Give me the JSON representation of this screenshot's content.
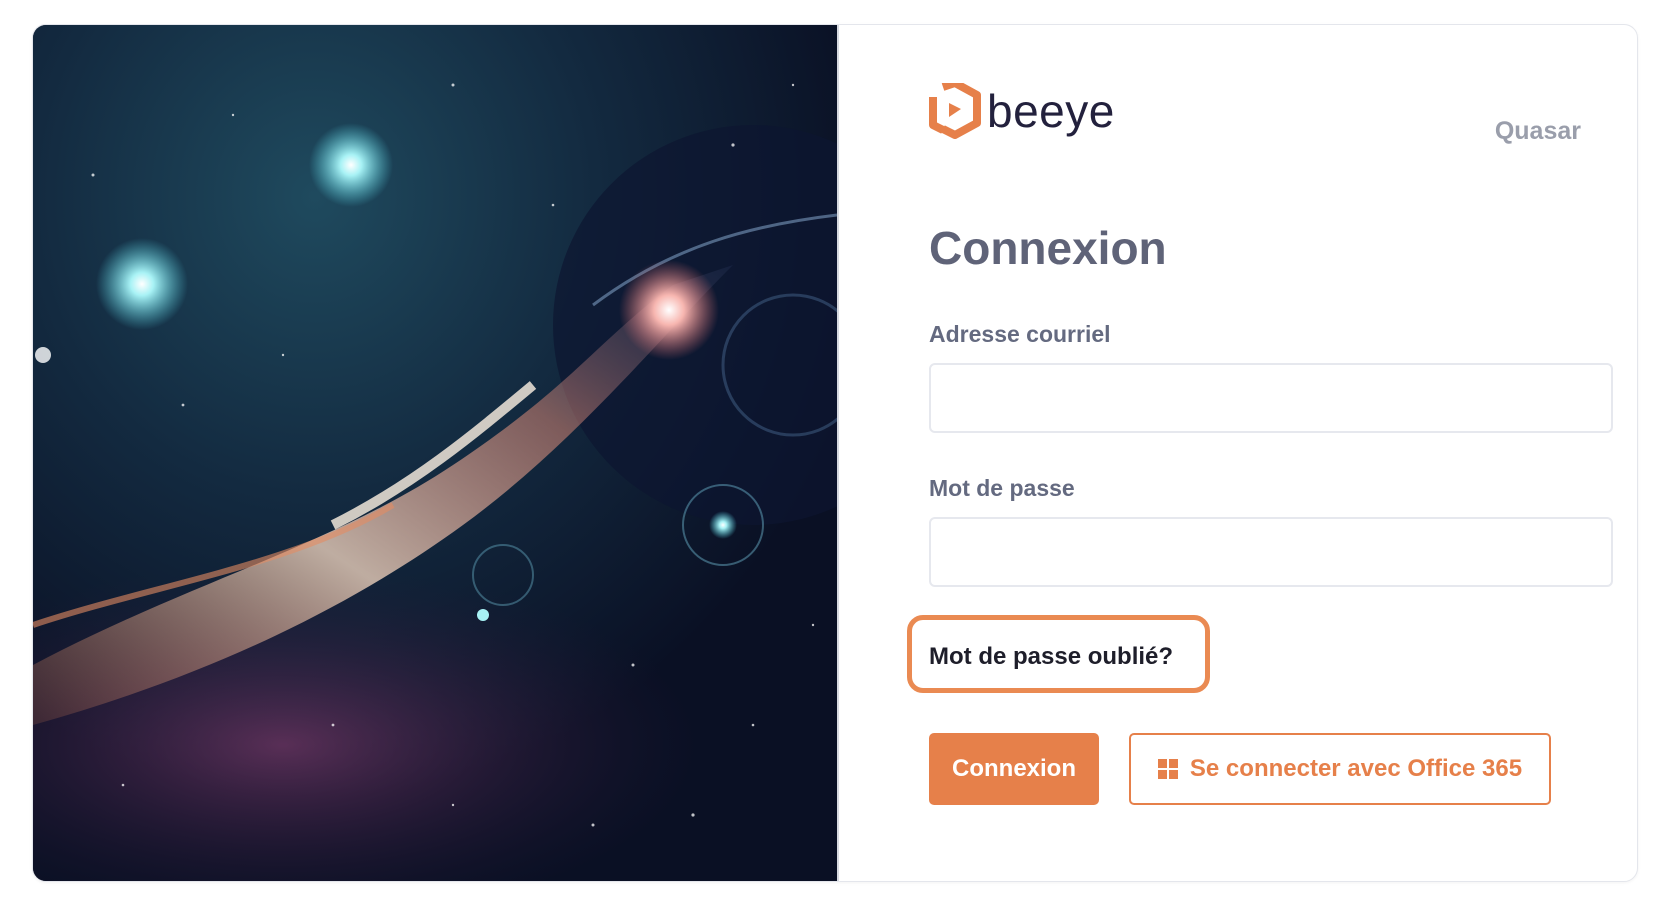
{
  "brand": {
    "logo_text": "beeye",
    "company_name": "Quasar",
    "accent_color": "#e6804a",
    "logo_icon": "beeye-hexagon-logo-icon"
  },
  "login": {
    "title": "Connexion",
    "email_label": "Adresse courriel",
    "email_value": "",
    "password_label": "Mot de passe",
    "password_value": "",
    "forgot_link": "Mot de passe oublié?",
    "submit_label": "Connexion",
    "office_label": "Se connecter avec Office 365",
    "office_icon": "windows-icon"
  },
  "hero": {
    "image_description_icon": "galaxy-space-image"
  }
}
